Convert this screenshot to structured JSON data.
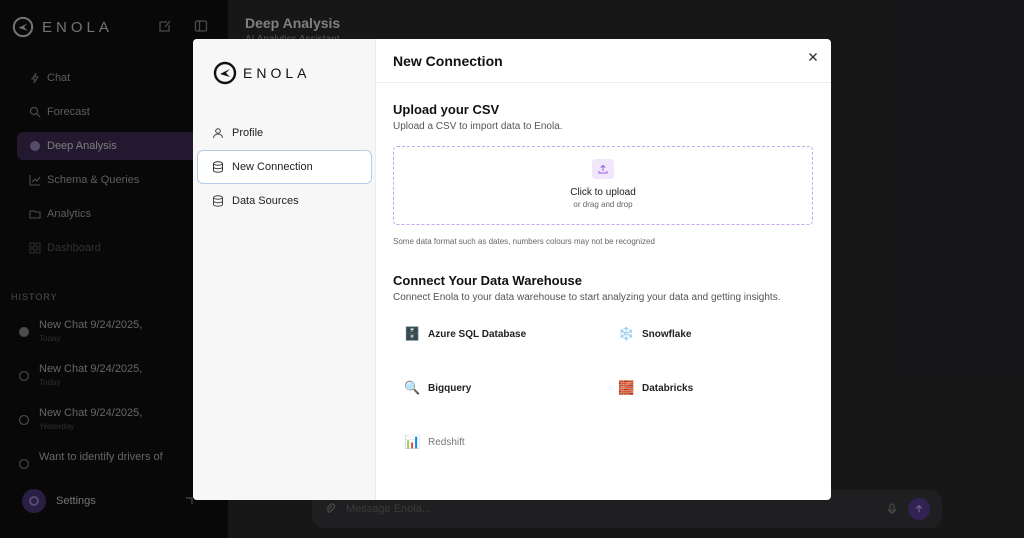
{
  "app": {
    "brand": "ENOLA",
    "nav": [
      {
        "label": "Chat",
        "icon": "bolt-icon"
      },
      {
        "label": "Forecast",
        "icon": "search-icon"
      },
      {
        "label": "Deep Analysis",
        "icon": "chat-icon"
      },
      {
        "label": "Schema & Queries",
        "icon": "chart-icon"
      },
      {
        "label": "Analytics",
        "icon": "folder-icon"
      },
      {
        "label": "Dashboard",
        "icon": "grid-icon"
      }
    ],
    "history_title": "HISTORY",
    "history": [
      {
        "title": "New Chat 9/24/2025,",
        "sub": "Today"
      },
      {
        "title": "New Chat 9/24/2025,",
        "sub": "Today"
      },
      {
        "title": "New Chat 9/24/2025,",
        "sub": "Yesterday"
      },
      {
        "title": "Want to identify drivers of",
        "sub": ""
      }
    ],
    "settings_label": "Settings",
    "main_title": "Deep Analysis",
    "main_subtitle": "AI Analytics Assistant",
    "chat_placeholder": "Message Enola..."
  },
  "modal": {
    "brand": "ENOLA",
    "nav": [
      {
        "label": "Profile"
      },
      {
        "label": "New Connection"
      },
      {
        "label": "Data Sources"
      }
    ],
    "title": "New Connection",
    "upload": {
      "heading": "Upload your CSV",
      "description": "Upload a CSV to import data to Enola.",
      "click_label": "Click to upload",
      "drag_label": "or drag and drop",
      "note": "Some data format such as dates, numbers colours may not be recognized"
    },
    "warehouse": {
      "heading": "Connect Your Data Warehouse",
      "description": "Connect Enola to your data warehouse to start analyzing your data and getting insights.",
      "connectors": [
        {
          "label": "Azure SQL Database",
          "emoji": "🗄️",
          "enabled": true
        },
        {
          "label": "Snowflake",
          "emoji": "❄️",
          "enabled": true
        },
        {
          "label": "Bigquery",
          "emoji": "🔍",
          "enabled": true
        },
        {
          "label": "Databricks",
          "emoji": "🧱",
          "enabled": true
        },
        {
          "label": "Redshift",
          "emoji": "📊",
          "enabled": false
        }
      ]
    }
  }
}
